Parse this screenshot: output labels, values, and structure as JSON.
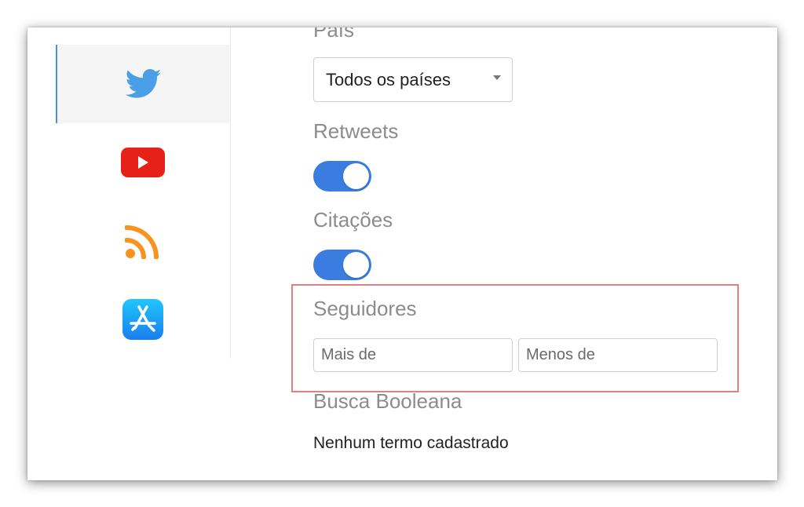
{
  "sidebar": {
    "items": [
      {
        "id": "twitter",
        "icon": "twitter-bird-icon",
        "color": "#4a9fe8",
        "active": true
      },
      {
        "id": "youtube",
        "icon": "youtube-play-icon",
        "color": "#e62117",
        "active": false
      },
      {
        "id": "rss",
        "icon": "rss-feed-icon",
        "color": "#f7931e",
        "active": false
      },
      {
        "id": "appstore",
        "icon": "app-store-icon",
        "color": "#1a8cf0",
        "active": false
      }
    ]
  },
  "filters": {
    "pais_label": "País",
    "pais_value": "Todos os países",
    "retweets_label": "Retweets",
    "retweets_on": true,
    "citacoes_label": "Citações",
    "citacoes_on": true,
    "seguidores_label": "Seguidores",
    "seguidores_min_placeholder": "Mais de",
    "seguidores_max_placeholder": "Menos de",
    "busca_label": "Busca Booleana",
    "busca_empty": "Nenhum termo cadastrado"
  },
  "colors": {
    "accent": "#3a7ce0",
    "highlight_border": "#e47f86"
  }
}
